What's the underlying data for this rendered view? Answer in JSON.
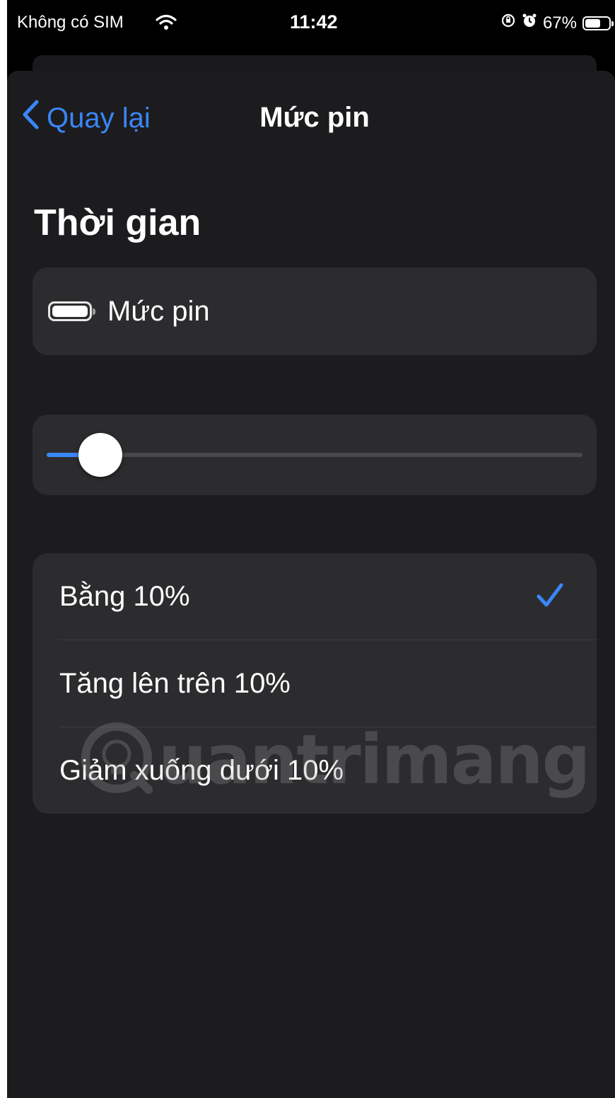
{
  "status_bar": {
    "carrier": "Không có SIM",
    "time": "11:42",
    "battery_percent": "67%",
    "battery_level": 0.67,
    "icons": [
      "wifi-icon",
      "orientation-lock-icon",
      "alarm-icon",
      "battery-icon"
    ]
  },
  "nav": {
    "back_label": "Quay lại",
    "title": "Mức pin"
  },
  "section": {
    "title": "Thời gian"
  },
  "condition": {
    "label": "Mức pin",
    "icon": "battery-icon"
  },
  "slider": {
    "value_percent": 10
  },
  "options": [
    {
      "label": "Bằng 10%",
      "selected": true
    },
    {
      "label": "Tăng lên trên 10%",
      "selected": false
    },
    {
      "label": "Giảm xuống dưới 10%",
      "selected": false
    }
  ],
  "watermark": {
    "text": "uantrimang"
  },
  "colors": {
    "accent": "#3a86f7",
    "sheet_background": "#1c1c1e",
    "card_background": "#2c2c2e"
  }
}
